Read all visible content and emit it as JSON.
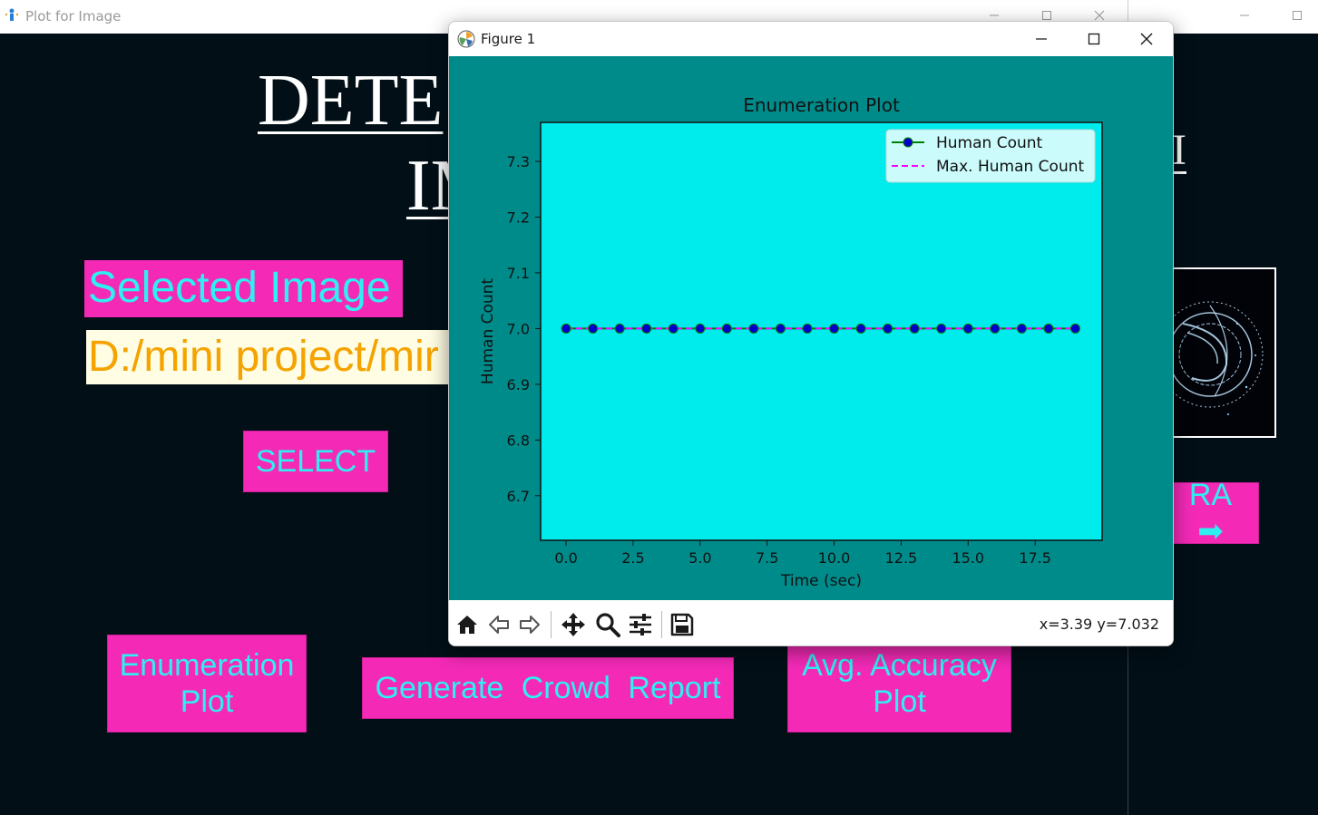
{
  "background_app": {
    "title": "Plot for Image",
    "heading_line1": "DETE",
    "heading_line2": "IM",
    "heading_right_fragment": "I",
    "selected_image_label": "Selected Image",
    "path_value": "D:/mini project/mir",
    "select_button": "SELECT",
    "enumeration_plot_button": "Enumeration Plot",
    "crowd_report_button": "Generate  Crowd  Report",
    "accuracy_plot_button": "Avg. Accuracy Plot",
    "camera_button": "RA ➡"
  },
  "figure_window": {
    "title": "Figure 1",
    "coord_readout": "x=3.39 y=7.032",
    "toolbar": [
      "home-icon",
      "back-icon",
      "forward-icon",
      "pan-icon",
      "zoom-icon",
      "configure-icon",
      "save-icon"
    ]
  },
  "colors": {
    "figure_bg": "#008b8b",
    "axes_bg": "#00ebeb",
    "human_count_line": "#008000",
    "human_count_marker": "#0000cd",
    "max_line": "#ff00ff",
    "button_bg": "#f42ab7",
    "button_text": "#2ef0f0",
    "app_bg": "#020f17"
  },
  "chart_data": {
    "type": "line",
    "title": "Enumeration Plot",
    "xlabel": "Time (sec)",
    "ylabel": "Human Count",
    "xlim": [
      -0.95,
      20
    ],
    "ylim": [
      6.62,
      7.37
    ],
    "xticks": [
      "0.0",
      "2.5",
      "5.0",
      "7.5",
      "10.0",
      "12.5",
      "15.0",
      "17.5"
    ],
    "xtick_values": [
      0,
      2.5,
      5,
      7.5,
      10,
      12.5,
      15,
      17.5
    ],
    "yticks": [
      "6.7",
      "6.8",
      "6.9",
      "7.0",
      "7.1",
      "7.2",
      "7.3"
    ],
    "ytick_values": [
      6.7,
      6.8,
      6.9,
      7.0,
      7.1,
      7.2,
      7.3
    ],
    "legend_position": "top-right",
    "x": [
      0,
      1,
      2,
      3,
      4,
      5,
      6,
      7,
      8,
      9,
      10,
      11,
      12,
      13,
      14,
      15,
      16,
      17,
      18,
      19
    ],
    "series": [
      {
        "name": "Human Count",
        "style": "solid-with-markers",
        "values": [
          7,
          7,
          7,
          7,
          7,
          7,
          7,
          7,
          7,
          7,
          7,
          7,
          7,
          7,
          7,
          7,
          7,
          7,
          7,
          7
        ]
      },
      {
        "name": "Max. Human Count",
        "style": "dashed",
        "values": [
          7,
          7,
          7,
          7,
          7,
          7,
          7,
          7,
          7,
          7,
          7,
          7,
          7,
          7,
          7,
          7,
          7,
          7,
          7,
          7
        ]
      }
    ]
  }
}
